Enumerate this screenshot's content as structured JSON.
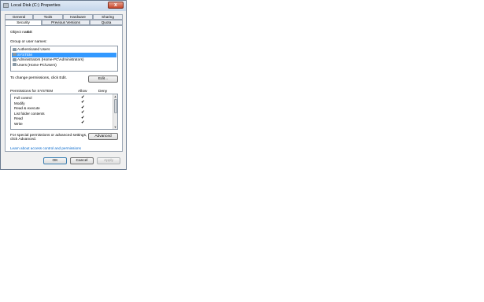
{
  "window": {
    "title": "Local Disk (C:) Properties",
    "close_symbol": "x"
  },
  "tabs_row1": [
    "General",
    "Tools",
    "Hardware",
    "Sharing"
  ],
  "tabs_row2": [
    "Security",
    "Previous Versions",
    "Quota"
  ],
  "active_tab": "Security",
  "security": {
    "object_name_label": "Object name:",
    "object_name_value": "C:\\",
    "groups_label": "Group or user names:",
    "groups": [
      "Authenticated Users",
      "SYSTEM",
      "Administrators (Home-PC\\Administrators)",
      "Users (Home-PC\\Users)"
    ],
    "selected_group": "SYSTEM",
    "change_text": "To change permissions, click Edit.",
    "edit_button": "Edit...",
    "permissions_label": "Permissions for SYSTEM",
    "allow_header": "Allow",
    "deny_header": "Deny",
    "permissions": [
      {
        "name": "Full control",
        "allow": "✔",
        "deny": ""
      },
      {
        "name": "Modify",
        "allow": "✔",
        "deny": ""
      },
      {
        "name": "Read & execute",
        "allow": "✔",
        "deny": ""
      },
      {
        "name": "List folder contents",
        "allow": "✔",
        "deny": ""
      },
      {
        "name": "Read",
        "allow": "✔",
        "deny": ""
      },
      {
        "name": "Write",
        "allow": "✔",
        "deny": ""
      }
    ],
    "special_text_line1": "For special permissions or advanced settings,",
    "special_text_line2": "click Advanced.",
    "advanced_button": "Advanced",
    "learn_link": "Learn about access control and permissions"
  },
  "buttons": {
    "ok": "OK",
    "cancel": "Cancel",
    "apply": "Apply"
  },
  "icons": {
    "group_icon": "users-icon",
    "window_icon": "drive-icon",
    "close": "close-icon"
  },
  "colors": {
    "selection": "#3399ff",
    "link": "#0066cc",
    "close": "#c6462b"
  }
}
